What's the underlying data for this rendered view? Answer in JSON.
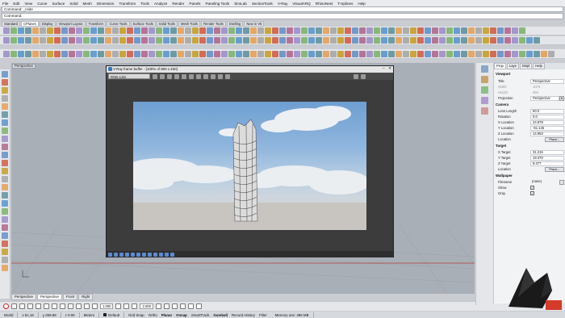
{
  "menubar": [
    "File",
    "Edit",
    "View",
    "Curve",
    "Surface",
    "Solid",
    "Mesh",
    "Dimension",
    "Transform",
    "Tools",
    "Analyze",
    "Render",
    "Panels",
    "Paneling Tools",
    "SimLab",
    "SectionTools",
    "V-Ray",
    "VisualARQ",
    "RhinoNest",
    "T-Splines",
    "Help"
  ],
  "command": {
    "history": "Command: _Hide",
    "prompt": "Command:"
  },
  "toolbar_tabs": [
    {
      "label": "Standard"
    },
    {
      "label": "CPlanes"
    },
    {
      "label": "Display"
    },
    {
      "label": "Viewport Layout"
    },
    {
      "label": "Transform"
    },
    {
      "label": "Curve Tools"
    },
    {
      "label": "Surface Tools"
    },
    {
      "label": "Solid Tools"
    },
    {
      "label": "Mesh Tools"
    },
    {
      "label": "Render Tools"
    },
    {
      "label": "Drafting"
    },
    {
      "label": "New in V6"
    }
  ],
  "viewport": {
    "title": "Perspective"
  },
  "vfb": {
    "title": "V-Ray frame buffer - [100% of 800 x 450]",
    "channel": "RGB color"
  },
  "viewport_tabs": [
    "Perspective",
    "Perspective",
    "Front",
    "Right"
  ],
  "osnap": {
    "value1": "1.000",
    "value2": "2.000"
  },
  "statusbar": {
    "cplane": "World",
    "x": "x 61.16",
    "y": "y 259.89",
    "z": "z 0.00",
    "units": "Meters",
    "layer": "Default",
    "toggles": [
      "Grid Snap",
      "Ortho",
      "Planar",
      "Osnap",
      "SmartTrack",
      "Gumball",
      "Record History",
      "Filter"
    ],
    "memory": "Memory use: 485 MB"
  },
  "properties": {
    "tabs": [
      "Prop",
      "Laye",
      "Displ",
      "Help"
    ],
    "viewport_header": "Viewport",
    "title_label": "Title",
    "title_value": "Perspective",
    "width_label": "Width",
    "width_value": "1075",
    "height_label": "Height",
    "height_value": "594",
    "projection_label": "Projection",
    "projection_value": "Perspective",
    "camera_header": "Camera",
    "lens_label": "Lens Length",
    "lens_value": "50.0",
    "rotation_label": "Rotation",
    "rotation_value": "0.0",
    "xloc_label": "X Location",
    "xloc_value": "24.878",
    "yloc_label": "Y Location",
    "yloc_value": "-61.145",
    "zloc_label": "Z Location",
    "zloc_value": "14.963",
    "location_label": "Location",
    "place_button": "Place...",
    "target_header": "Target",
    "xtgt_label": "X Target",
    "xtgt_value": "31.215",
    "ytgt_label": "Y Target",
    "ytgt_value": "19.370",
    "ztgt_label": "Z Target",
    "ztgt_value": "9.477",
    "tloc_label": "Location",
    "tplace_button": "Place...",
    "wallpaper_header": "Wallpaper",
    "filename_label": "Filename",
    "filename_value": "(none)",
    "show_label": "Show",
    "gray_label": "Gray"
  },
  "colors": {
    "accent": "#1a73c8",
    "toolbar": "#e4e6ea",
    "viewport": "#a9afb7",
    "vfb": "#3b3b3b"
  }
}
